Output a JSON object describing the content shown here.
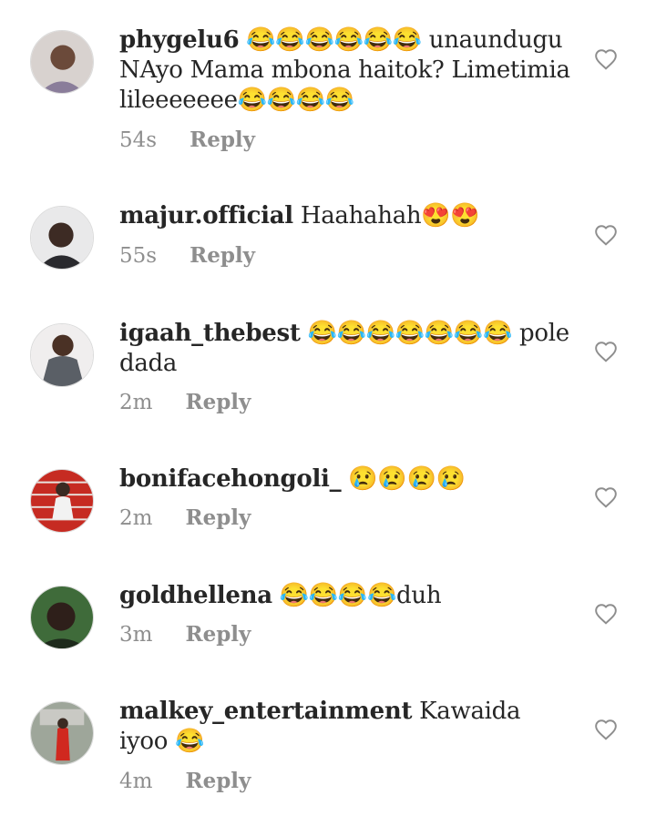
{
  "comments": [
    {
      "username": "phygelu6",
      "text": "😂😂😂😂😂😂 unaundugu NAyo Mama mbona haitok? Limetimia lileeeeeee😂😂😂😂",
      "time": "54s",
      "reply": "Reply",
      "icon": "heart-outline-icon"
    },
    {
      "username": "majur.official",
      "text": "Haahahah😍😍",
      "time": "55s",
      "reply": "Reply",
      "icon": "heart-outline-icon"
    },
    {
      "username": "igaah_thebest",
      "text": "😂😂😂😂😂😂😂 pole dada",
      "time": "2m",
      "reply": "Reply",
      "icon": "heart-outline-icon"
    },
    {
      "username": "bonifacehongoli_",
      "text": "😢😢😢😢",
      "time": "2m",
      "reply": "Reply",
      "icon": "heart-outline-icon"
    },
    {
      "username": "goldhellena",
      "text": "😂😂😂😂duh",
      "time": "3m",
      "reply": "Reply",
      "icon": "heart-outline-icon"
    },
    {
      "username": "malkey_entertainment",
      "text": "Kawaida  iyoo 😂",
      "time": "4m",
      "reply": "Reply",
      "icon": "heart-outline-icon"
    }
  ],
  "colors": {
    "username": "#262626",
    "meta": "#8e8e8e",
    "border": "#dbdbdb"
  }
}
